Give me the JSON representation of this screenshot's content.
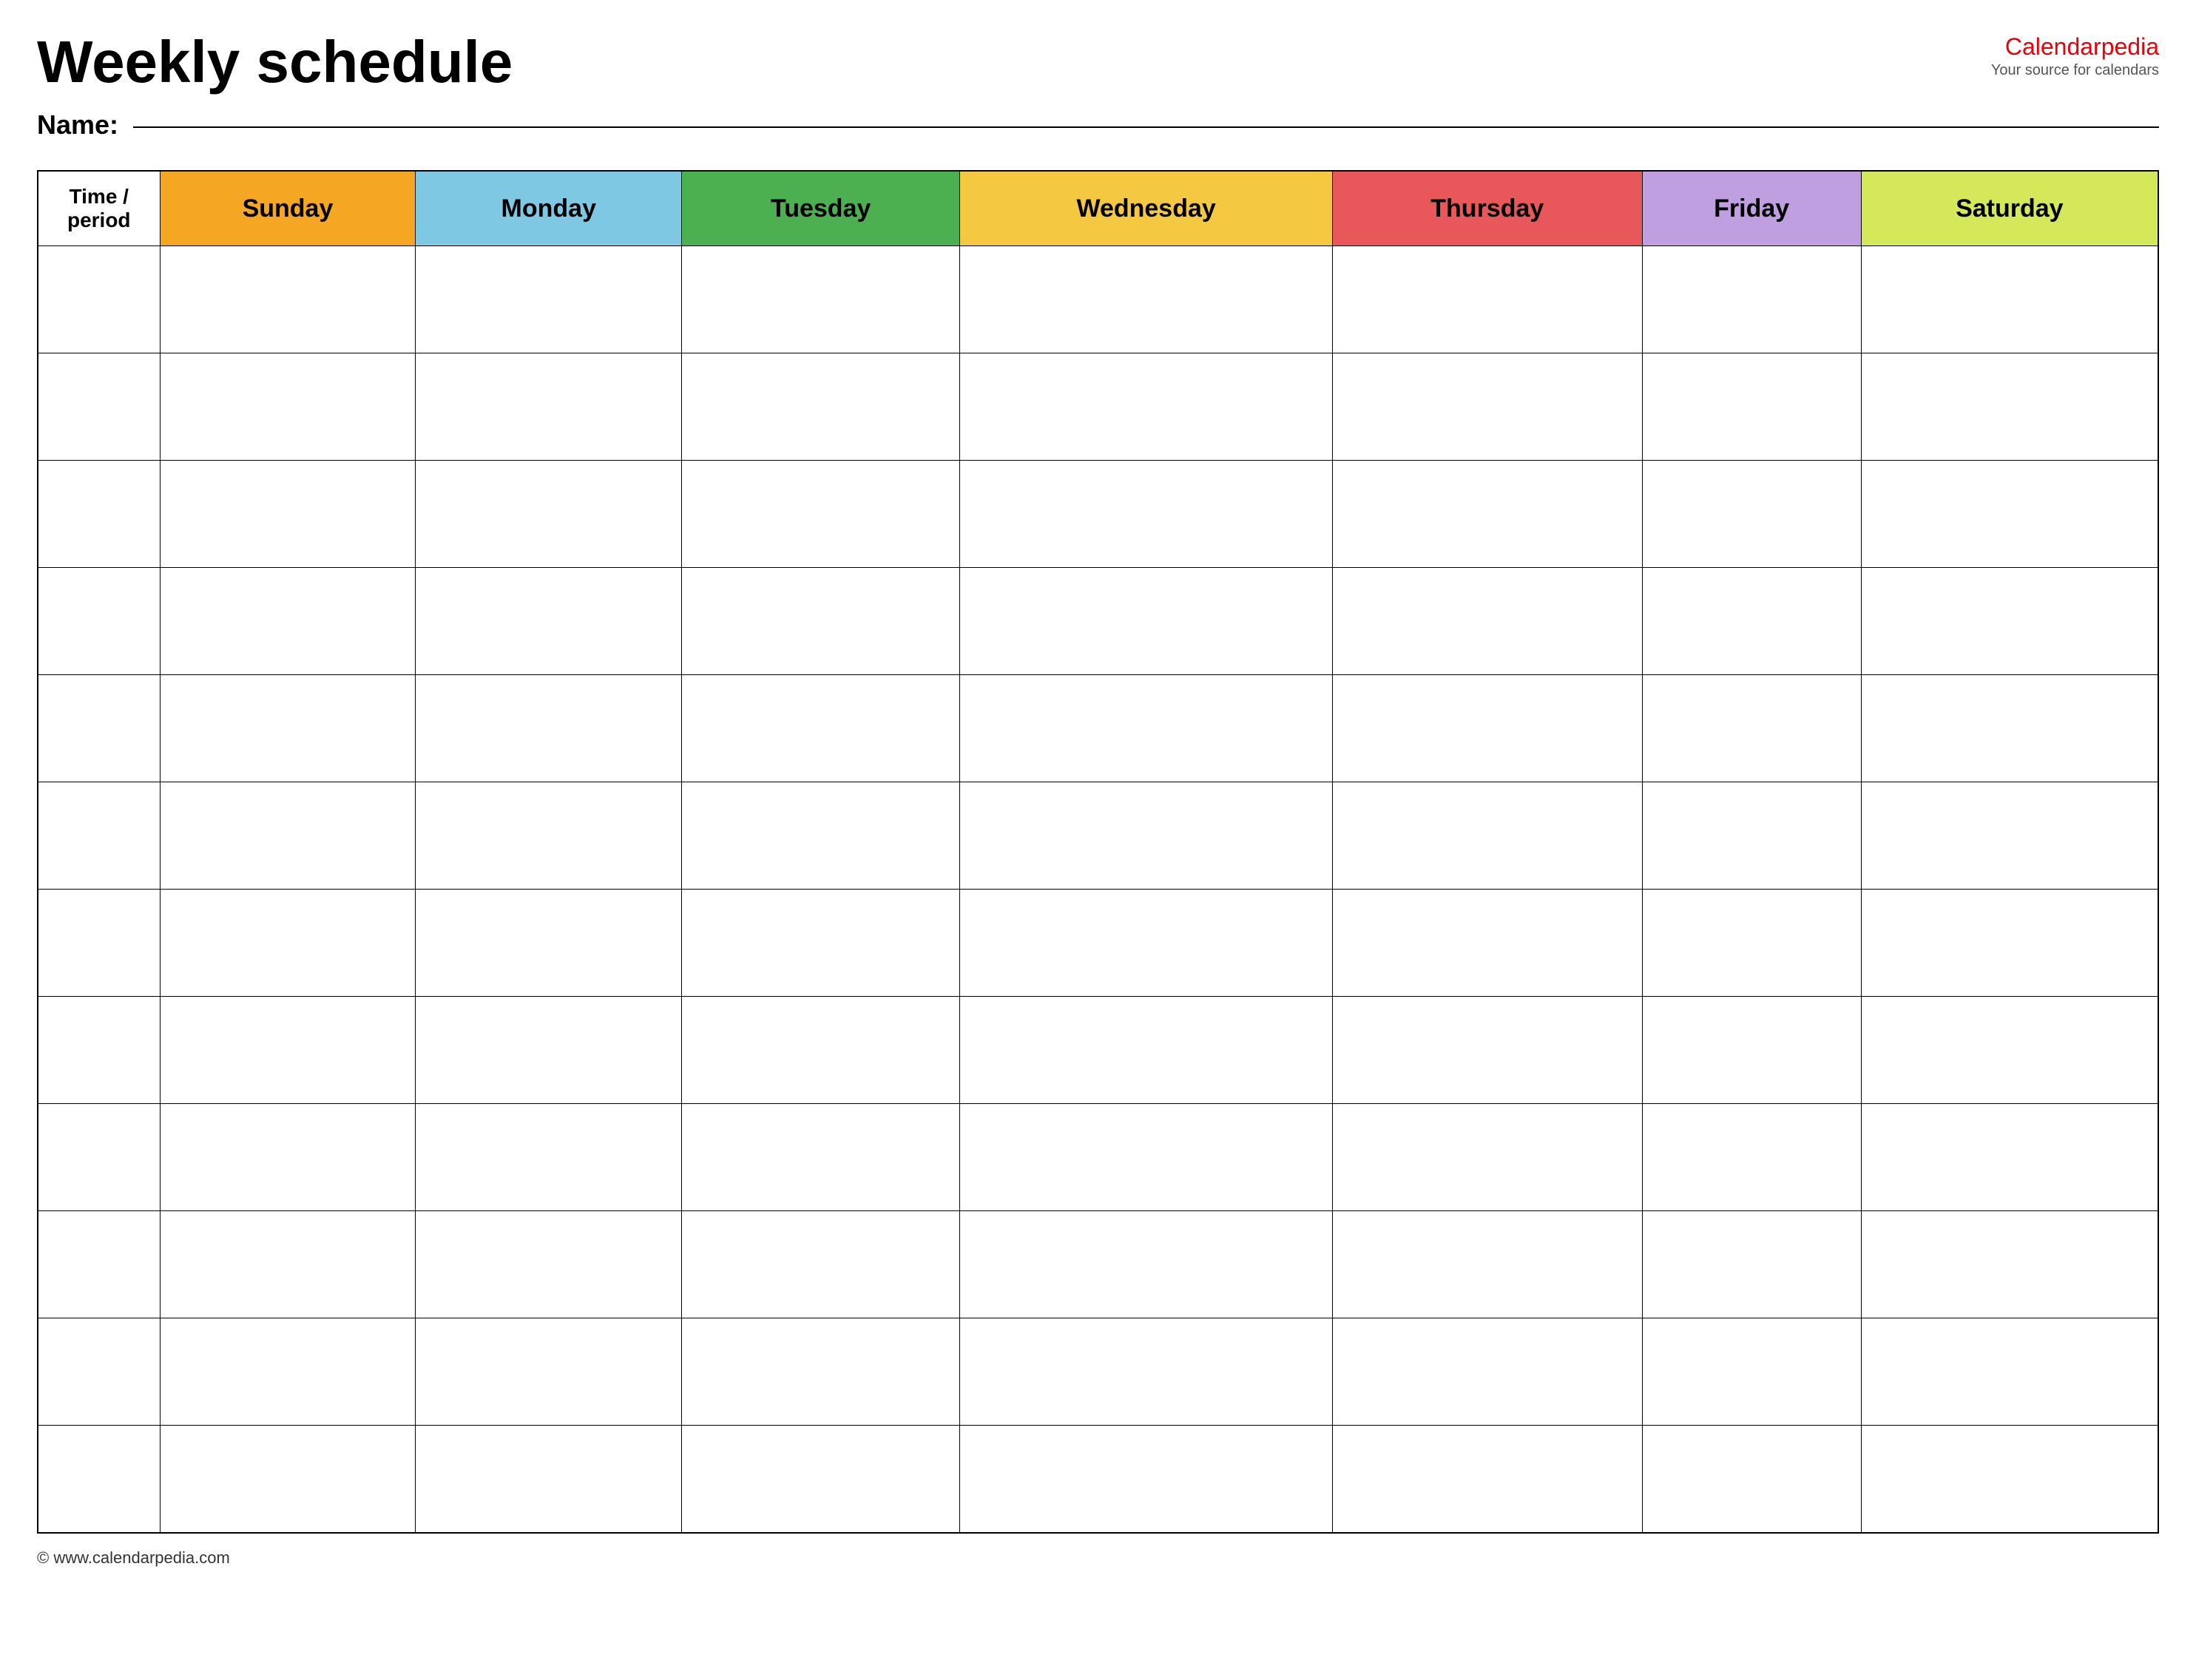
{
  "header": {
    "title": "Weekly schedule",
    "brand": {
      "name_part1": "Calendar",
      "name_part2": "pedia",
      "tagline": "Your source for calendars"
    },
    "name_label": "Name:"
  },
  "table": {
    "columns": [
      {
        "key": "time",
        "label": "Time / period",
        "color": "#ffffff",
        "class": "col-time"
      },
      {
        "key": "sunday",
        "label": "Sunday",
        "color": "#f5a623",
        "class": "col-sunday"
      },
      {
        "key": "monday",
        "label": "Monday",
        "color": "#7ec8e3",
        "class": "col-monday"
      },
      {
        "key": "tuesday",
        "label": "Tuesday",
        "color": "#4caf50",
        "class": "col-tuesday"
      },
      {
        "key": "wednesday",
        "label": "Wednesday",
        "color": "#f5c842",
        "class": "col-wednesday"
      },
      {
        "key": "thursday",
        "label": "Thursday",
        "color": "#e8575a",
        "class": "col-thursday"
      },
      {
        "key": "friday",
        "label": "Friday",
        "color": "#bf9fdf",
        "class": "col-friday"
      },
      {
        "key": "saturday",
        "label": "Saturday",
        "color": "#d4e85a",
        "class": "col-saturday"
      }
    ],
    "row_count": 12
  },
  "footer": {
    "url": "www.calendarpedia.com"
  }
}
